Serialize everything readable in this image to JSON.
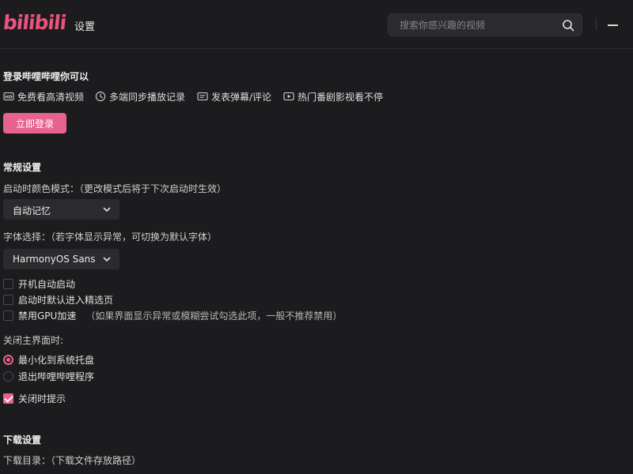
{
  "app": {
    "logo_text": "bilibili",
    "page_title": "设置"
  },
  "search": {
    "placeholder": "搜索你感兴趣的视频",
    "value": ""
  },
  "login": {
    "title": "登录哔哩哔哩你可以",
    "benefits": [
      {
        "icon": "hd-icon",
        "label": "免费看高清视频"
      },
      {
        "icon": "clock-icon",
        "label": "多端同步播放记录"
      },
      {
        "icon": "comment-icon",
        "label": "发表弹幕/评论"
      },
      {
        "icon": "play-icon",
        "label": "热门番剧影视看不停"
      }
    ],
    "button_label": "立即登录"
  },
  "general": {
    "title": "常规设置",
    "color_mode": {
      "label": "启动时颜色模式：（更改模式后将于下次启动时生效）",
      "selected": "自动记忆"
    },
    "font": {
      "label": "字体选择：（若字体显示异常，可切换为默认字体）",
      "selected": "HarmonyOS Sans"
    },
    "checkboxes": [
      {
        "label": "开机自动启动",
        "hint": "",
        "checked": false
      },
      {
        "label": "启动时默认进入精选页",
        "hint": "",
        "checked": false
      },
      {
        "label": "禁用GPU加速",
        "hint": "（如果界面显示异常或模糊尝试勾选此项，一般不推荐禁用）",
        "checked": false
      }
    ],
    "close_behavior": {
      "label": "关闭主界面时:",
      "options": [
        {
          "label": "最小化到系统托盘",
          "selected": true
        },
        {
          "label": "退出哔哩哔哩程序",
          "selected": false
        }
      ]
    },
    "close_prompt": {
      "label": "关闭时提示",
      "checked": true
    }
  },
  "download": {
    "title": "下载设置",
    "dir_label": "下载目录：（下载文件存放路径）"
  },
  "colors": {
    "accent": "#e8628f",
    "logo": "#e8537f",
    "background": "#1c1c1e"
  }
}
